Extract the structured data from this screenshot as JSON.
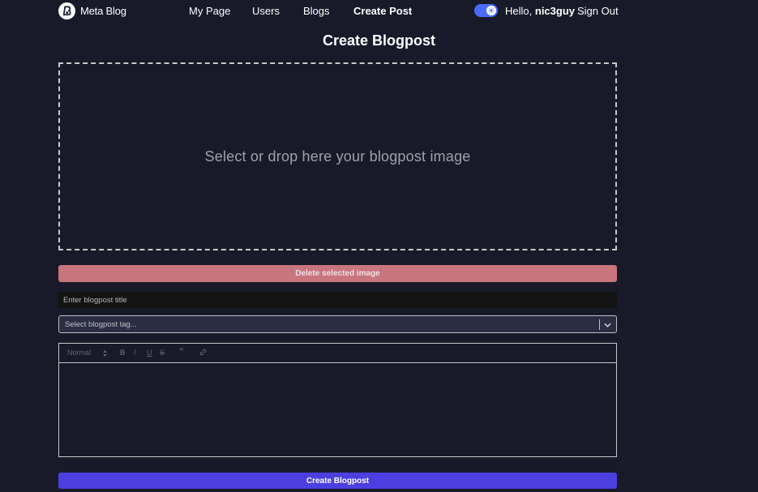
{
  "brand": {
    "name": "Meta Blog"
  },
  "nav": {
    "links": [
      {
        "label": "My Page"
      },
      {
        "label": "Users"
      },
      {
        "label": "Blogs"
      },
      {
        "label": "Create Post"
      }
    ],
    "theme_toggle_on": true,
    "greeting_prefix": "Hello,",
    "username": "nic3guy",
    "signout_label": "Sign Out"
  },
  "page": {
    "title": "Create Blogpost"
  },
  "dropzone": {
    "text": "Select or drop here your blogpost image"
  },
  "delete_button": {
    "label": "Delete selected image"
  },
  "title_input": {
    "placeholder": "Enter blogpost title",
    "value": ""
  },
  "tag_select": {
    "placeholder": "Select blogpost tag..."
  },
  "editor_toolbar": {
    "heading_select": "Normal",
    "bold": "B",
    "italic": "I",
    "underline": "U",
    "strike": "S",
    "quote": "”",
    "link_icon": "link-icon"
  },
  "submit_button": {
    "label": "Create Blogpost"
  },
  "colors": {
    "background": "#181a2a",
    "accent": "#4b6bfb",
    "submit": "#4b3fe0",
    "delete": "#c9757e"
  }
}
